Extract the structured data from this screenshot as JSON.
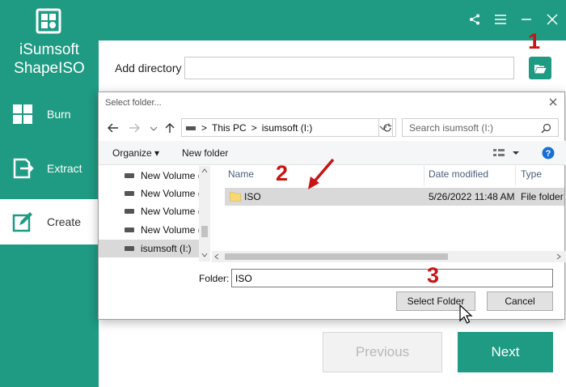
{
  "app": {
    "title_line1": "iSumsoft",
    "title_line2": "ShapeISO"
  },
  "sidebar": {
    "items": [
      {
        "label": "Burn",
        "icon": "grid-icon"
      },
      {
        "label": "Extract",
        "icon": "extract-icon"
      },
      {
        "label": "Create",
        "icon": "edit-icon",
        "active": true
      }
    ]
  },
  "window_controls": [
    "share-icon",
    "menu-icon",
    "minimize-icon",
    "close-icon"
  ],
  "main": {
    "add_directory_label": "Add directory",
    "directory_value": "",
    "previous_label": "Previous",
    "next_label": "Next"
  },
  "dialog": {
    "title": "Select folder...",
    "address": {
      "root": "This PC",
      "sep": ">",
      "drive": "isumsoft (I:)"
    },
    "search_placeholder": "Search isumsoft (I:)",
    "organize_label": "Organize ▾",
    "new_folder_label": "New folder",
    "tree": [
      "New Volume (E",
      "New Volume (E",
      "New Volume (F",
      "New Volume (C",
      "isumsoft (I:)"
    ],
    "columns": {
      "name": "Name",
      "date": "Date modified",
      "type": "Type"
    },
    "files": [
      {
        "name": "ISO",
        "date": "5/26/2022 11:48 AM",
        "type": "File folder"
      }
    ],
    "folder_label": "Folder:",
    "folder_value": "ISO",
    "select_button": "Select Folder",
    "cancel_button": "Cancel"
  },
  "annotations": [
    "1",
    "2",
    "3"
  ],
  "colors": {
    "brand": "#1f9a83",
    "annotation": "#c91414",
    "selection": "#d9d9d9"
  }
}
